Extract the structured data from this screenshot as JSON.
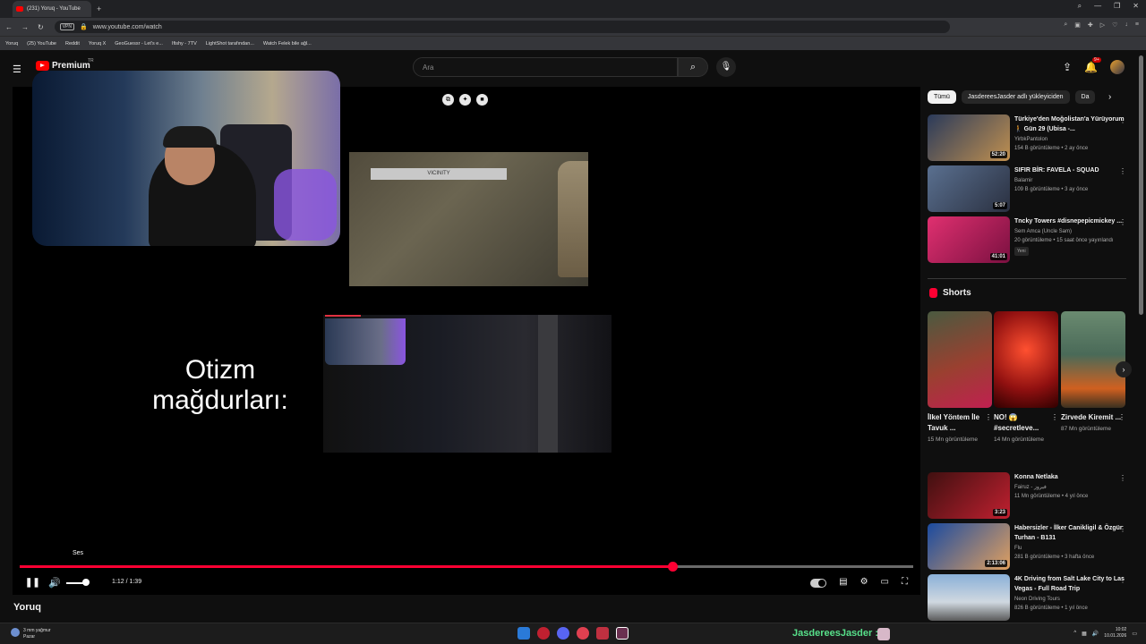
{
  "browser": {
    "tab_title": "(231) Yoruq - YouTube",
    "new_tab": "+",
    "vpn": "VPN",
    "url": "www.youtube.com/watch",
    "bookmarks": [
      "Yoruq",
      "(25) YouTube",
      "Reddit",
      "Yoruq X",
      "GeoGuessr - Let's e...",
      "Ifishy - 7TV",
      "LightShot tarafından...",
      "Watch Felek bile ağl..."
    ]
  },
  "youtube": {
    "logo_text": "Premium",
    "region": "TR",
    "search_placeholder": "Ara",
    "notif_count": "9+"
  },
  "player": {
    "overlay_text": "Otizm mağdurları:",
    "game_hud_text": "VICINITY",
    "volume_tooltip": "Ses",
    "time": "1:12 / 1:39",
    "progress": 0.73,
    "volume_level": 0.6
  },
  "video": {
    "channel_title": "Yoruq"
  },
  "chips": {
    "items": [
      "Tümü",
      "JasdereesJasder adlı yükleyiciden",
      "Da"
    ]
  },
  "recs_top": [
    {
      "title": "Türkiye'den Moğolistan'a Yürüyorum 🚶 Gün 29 (Ubisa -...",
      "channel": "YirbkPantolon",
      "stats": "154 B görüntüleme • 2 ay önce",
      "duration": "52:20",
      "color": "#8a6a3a"
    },
    {
      "title": "SIFIR BİR: FAVELA - SQUAD",
      "channel": "Balamir",
      "stats": "109 B görüntüleme • 3 ay önce",
      "duration": "5:07",
      "color": "#3a4a60"
    },
    {
      "title": "Tncky Towers #disnepepicmickey ...",
      "channel": "Sem Amca (Uncle Sam)",
      "stats": "20 görüntüleme • 15 saat önce yayınlandı",
      "duration": "41:01",
      "tag": "Yeni",
      "color": "#c02060"
    }
  ],
  "shorts": {
    "heading": "Shorts",
    "items": [
      {
        "title": "İlkel Yöntem İle Tavuk ...",
        "views": "15 Mn görüntüleme",
        "color": "#9a4030"
      },
      {
        "title": "NO! 😱 #secretleve...",
        "views": "14 Mn görüntüleme",
        "color": "#b02010"
      },
      {
        "title": "Zirvede Kiremit ...",
        "views": "87 Mn görüntüleme",
        "color": "#4a6a58"
      }
    ]
  },
  "recs_bottom": [
    {
      "title": "Konna Netlaka",
      "channel": "Fairuz - فيروز",
      "stats": "11 Mn görüntüleme • 4 yıl önce",
      "duration": "3:23",
      "color": "#b82030"
    },
    {
      "title": "Habersizler - İlker Canikligil & Özgür Turhan - B131",
      "channel": "Flu",
      "stats": "281 B görüntüleme • 3 hafta önce",
      "duration": "2:13:06",
      "color": "#2050a0"
    },
    {
      "title": "4K Driving from Salt Lake City to Las Vegas - Full Road Trip",
      "channel": "Neon Driving Tours",
      "stats": "826 B görüntüleme • 1 yıl önce",
      "duration": "",
      "color": "#6a90b8"
    }
  ],
  "taskbar": {
    "weather_line1": "3 mm yağmur",
    "weather_line2": "Pazar",
    "user_label": "JasdereesJasder :",
    "time": "10:02",
    "date": "10.01.2026"
  }
}
